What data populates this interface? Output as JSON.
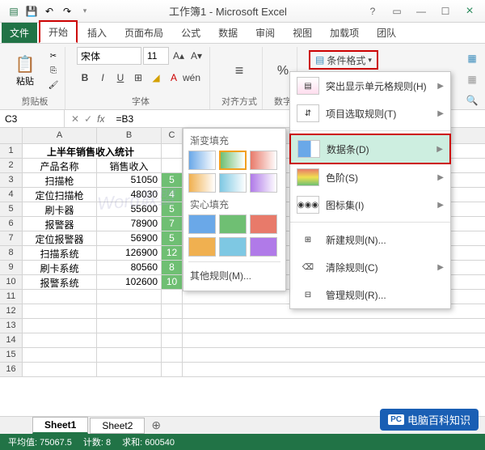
{
  "titlebar": {
    "title": "工作簿1 - Microsoft Excel"
  },
  "tabs": {
    "file": "文件",
    "home": "开始",
    "insert": "插入",
    "layout": "页面布局",
    "formulas": "公式",
    "data": "数据",
    "review": "审阅",
    "view": "视图",
    "addins": "加载项",
    "team": "团队"
  },
  "ribbon": {
    "paste": "粘贴",
    "clipboard_label": "剪贴板",
    "font_name": "宋体",
    "font_size": "11",
    "font_label": "字体",
    "align_label": "对齐方式",
    "number_label": "数字",
    "percent": "%",
    "cond_fmt": "条件格式",
    "bold": "B",
    "italic": "I",
    "underline": "U"
  },
  "formula_bar": {
    "cell_ref": "C3",
    "formula": "=B3"
  },
  "columns": [
    "A",
    "B",
    "C"
  ],
  "sheet_title": "上半年销售收入统计",
  "headers": {
    "a": "产品名称",
    "b": "销售收入"
  },
  "rows": [
    {
      "n": "3",
      "a": "扫描枪",
      "b": "51050",
      "c": "5"
    },
    {
      "n": "4",
      "a": "定位扫描枪",
      "b": "48030",
      "c": "4"
    },
    {
      "n": "5",
      "a": "刷卡器",
      "b": "55600",
      "c": "5"
    },
    {
      "n": "6",
      "a": "报警器",
      "b": "78900",
      "c": "7"
    },
    {
      "n": "7",
      "a": "定位报警器",
      "b": "56900",
      "c": "5"
    },
    {
      "n": "8",
      "a": "扫描系统",
      "b": "126900",
      "c": "12"
    },
    {
      "n": "9",
      "a": "刷卡系统",
      "b": "80560",
      "c": "8"
    },
    {
      "n": "10",
      "a": "报警系统",
      "b": "102600",
      "c": "10"
    }
  ],
  "empty_rows": [
    "11",
    "12",
    "13",
    "14",
    "15",
    "16"
  ],
  "submenu": {
    "gradient_label": "渐变填充",
    "solid_label": "实心填充",
    "other_rules": "其他规则(M)..."
  },
  "menu": {
    "highlight": "突出显示单元格规则(H)",
    "top_bottom": "项目选取规则(T)",
    "data_bars": "数据条(D)",
    "color_scales": "色阶(S)",
    "icon_sets": "图标集(I)",
    "new_rule": "新建规则(N)...",
    "clear_rules": "清除规则(C)",
    "manage_rules": "管理规则(R)..."
  },
  "sheets": {
    "s1": "Sheet1",
    "s2": "Sheet2",
    "plus": "⊕"
  },
  "status": {
    "avg_label": "平均值:",
    "avg": "75067.5",
    "count_label": "计数:",
    "count": "8",
    "sum_label": "求和:",
    "sum": "600540"
  },
  "logo": "电脑百科知识"
}
